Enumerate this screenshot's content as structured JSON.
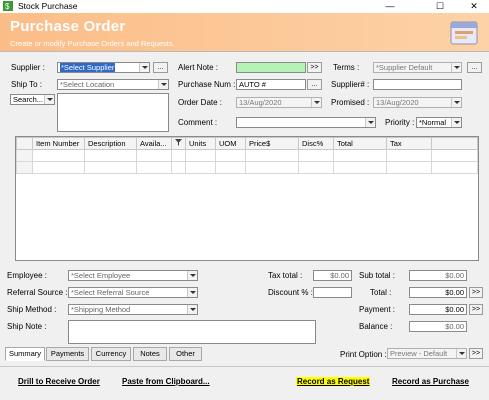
{
  "window": {
    "title": "Stock Purchase",
    "minimize": "—",
    "maximize": "☐",
    "close": "✕"
  },
  "header": {
    "title": "Purchase Order",
    "subtitle": "Create or modify Purchase Orders and Requests."
  },
  "form": {
    "supplier_label": "Supplier :",
    "supplier_value": "*Select Supplier",
    "shipto_label": "Ship To :",
    "shipto_value": "*Select Location",
    "search_label": "Search...",
    "alert_note_label": "Alert Note :",
    "alert_note_value": "",
    "purchase_num_label": "Purchase Num :",
    "purchase_num_value": "AUTO #",
    "order_date_label": "Order Date :",
    "order_date_value": "13/Aug/2020",
    "comment_label": "Comment :",
    "comment_value": "",
    "terms_label": "Terms :",
    "terms_value": "*Supplier Default",
    "supplier_num_label": "Supplier# :",
    "supplier_num_value": "",
    "promised_label": "Promised :",
    "promised_value": "13/Aug/2020",
    "priority_label": "Priority :",
    "priority_value": "*Normal",
    "ellipsis": "...",
    "arrow_btn": ">>"
  },
  "grid": {
    "columns": [
      "",
      "Item Number",
      "Description",
      "Availa...",
      "",
      "Units",
      "UOM",
      "Price$",
      "Disc%",
      "Total",
      "Tax",
      ""
    ]
  },
  "footer": {
    "employee_label": "Employee :",
    "employee_value": "*Select Employee",
    "referral_label": "Referral Source :",
    "referral_value": "*Select Referral Source",
    "ship_method_label": "Ship Method :",
    "ship_method_value": "*Shipping Method",
    "ship_note_label": "Ship Note :",
    "tax_total_label": "Tax total :",
    "tax_total_value": "$0.00",
    "discount_label": "Discount % :",
    "discount_value": "",
    "subtotal_label": "Sub total :",
    "subtotal_value": "$0.00",
    "total_label": "Total :",
    "total_value": "$0.00",
    "payment_label": "Payment :",
    "payment_value": "$0.00",
    "balance_label": "Balance :",
    "balance_value": "$0.00",
    "print_option_label": "Print Option :",
    "print_option_value": "Preview - Default"
  },
  "tabs": [
    "Summary",
    "Payments",
    "Currency",
    "Notes",
    "Other"
  ],
  "actions": {
    "drill": "Drill to Receive Order",
    "paste": "Paste from Clipboard...",
    "record_request": "Record as Request",
    "record_purchase": "Record as Purchase"
  },
  "colors": {
    "header_accent": "#fbbd88",
    "alert_note_bg": "#b4f3b4",
    "highlight": "#ffff00"
  }
}
